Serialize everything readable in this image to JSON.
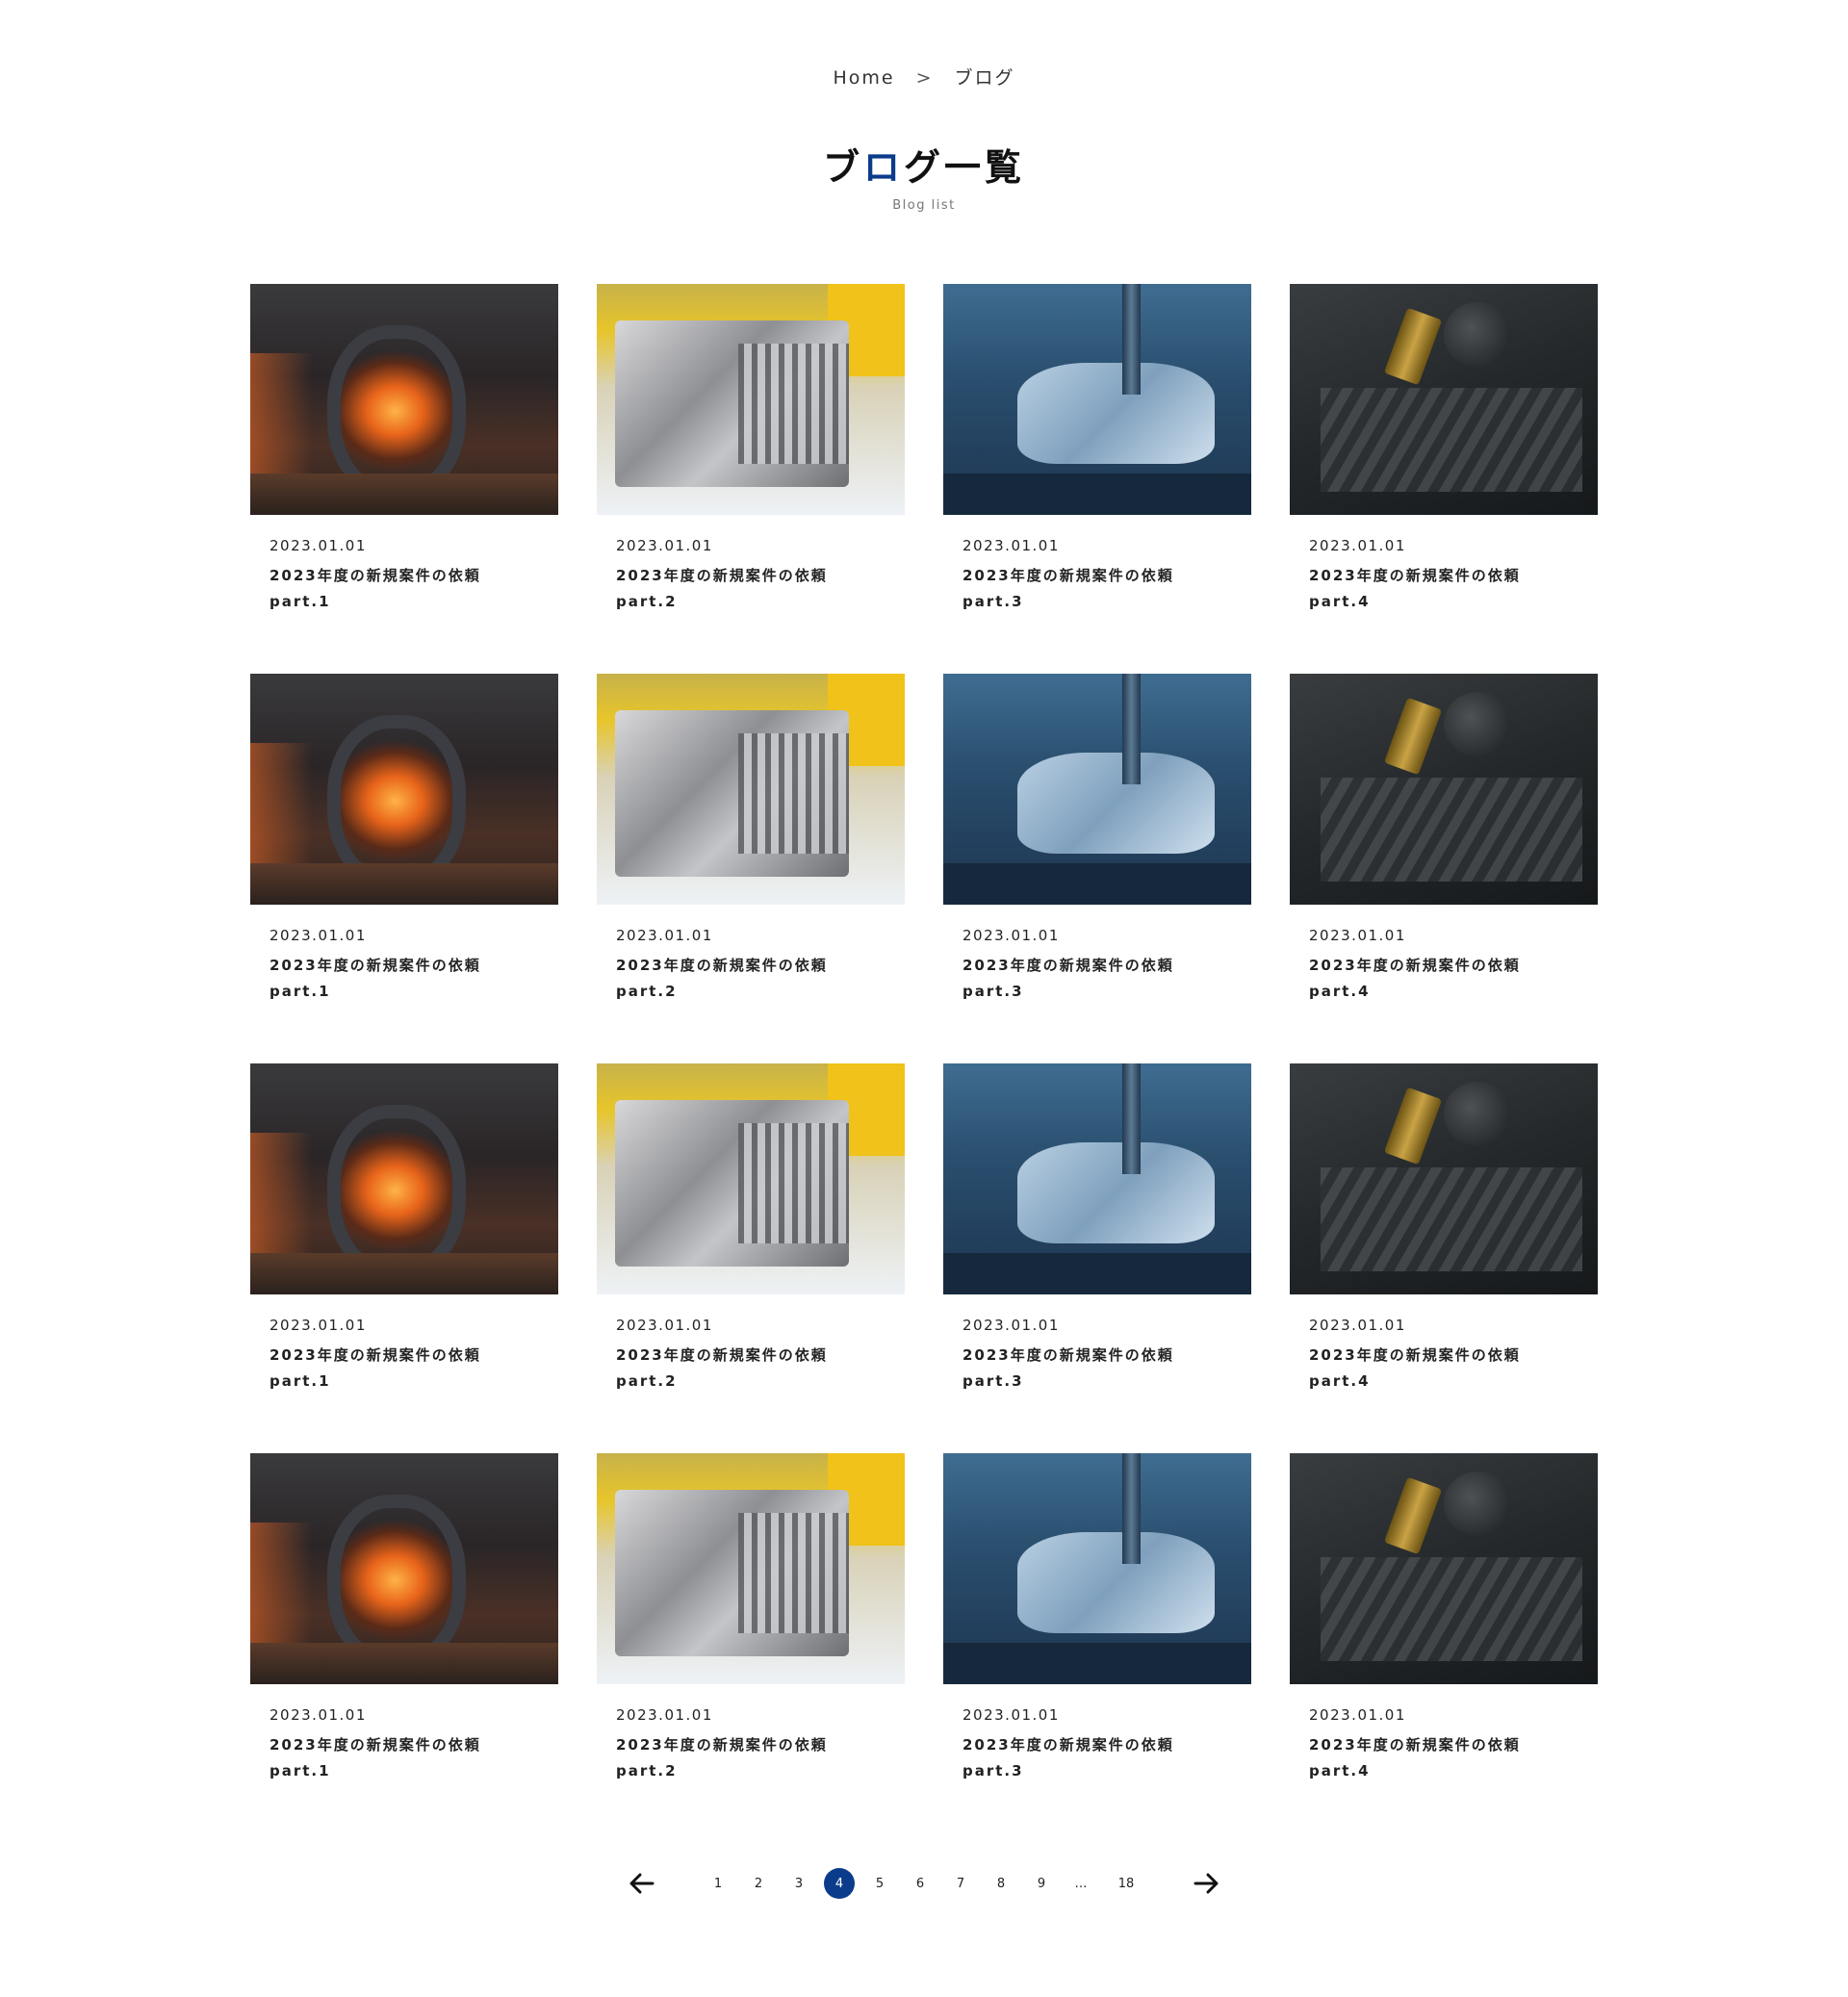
{
  "breadcrumb": {
    "home": "Home",
    "separator": ">",
    "current": "ブログ"
  },
  "heading": {
    "title_part1": "ブ",
    "title_accent": "ロ",
    "title_part2": "グ一覧",
    "subtitle": "Blog list",
    "accent_color": "#0b3c8c"
  },
  "posts": [
    {
      "date": "2023.01.01",
      "title": "2023年度の新規案件の依頼part.1",
      "image": "forge-image"
    },
    {
      "date": "2023.01.01",
      "title": "2023年度の新規案件の依頼part.2",
      "image": "casting-image"
    },
    {
      "date": "2023.01.01",
      "title": "2023年度の新規案件の依頼part.3",
      "image": "machining-image"
    },
    {
      "date": "2023.01.01",
      "title": "2023年度の新規案件の依頼part.4",
      "image": "tools-image"
    },
    {
      "date": "2023.01.01",
      "title": "2023年度の新規案件の依頼part.1",
      "image": "forge-image"
    },
    {
      "date": "2023.01.01",
      "title": "2023年度の新規案件の依頼part.2",
      "image": "casting-image"
    },
    {
      "date": "2023.01.01",
      "title": "2023年度の新規案件の依頼part.3",
      "image": "machining-image"
    },
    {
      "date": "2023.01.01",
      "title": "2023年度の新規案件の依頼part.4",
      "image": "tools-image"
    },
    {
      "date": "2023.01.01",
      "title": "2023年度の新規案件の依頼part.1",
      "image": "forge-image"
    },
    {
      "date": "2023.01.01",
      "title": "2023年度の新規案件の依頼part.2",
      "image": "casting-image"
    },
    {
      "date": "2023.01.01",
      "title": "2023年度の新規案件の依頼part.3",
      "image": "machining-image"
    },
    {
      "date": "2023.01.01",
      "title": "2023年度の新規案件の依頼part.4",
      "image": "tools-image"
    },
    {
      "date": "2023.01.01",
      "title": "2023年度の新規案件の依頼part.1",
      "image": "forge-image"
    },
    {
      "date": "2023.01.01",
      "title": "2023年度の新規案件の依頼part.2",
      "image": "casting-image"
    },
    {
      "date": "2023.01.01",
      "title": "2023年度の新規案件の依頼part.3",
      "image": "machining-image"
    },
    {
      "date": "2023.01.01",
      "title": "2023年度の新規案件の依頼part.4",
      "image": "tools-image"
    }
  ],
  "pagination": {
    "prev_icon": "arrow-left-icon",
    "next_icon": "arrow-right-icon",
    "pages": [
      "1",
      "2",
      "3",
      "4",
      "5",
      "6",
      "7",
      "8",
      "9",
      "…",
      "18"
    ],
    "current": "4",
    "active_color": "#0b3c8c"
  }
}
